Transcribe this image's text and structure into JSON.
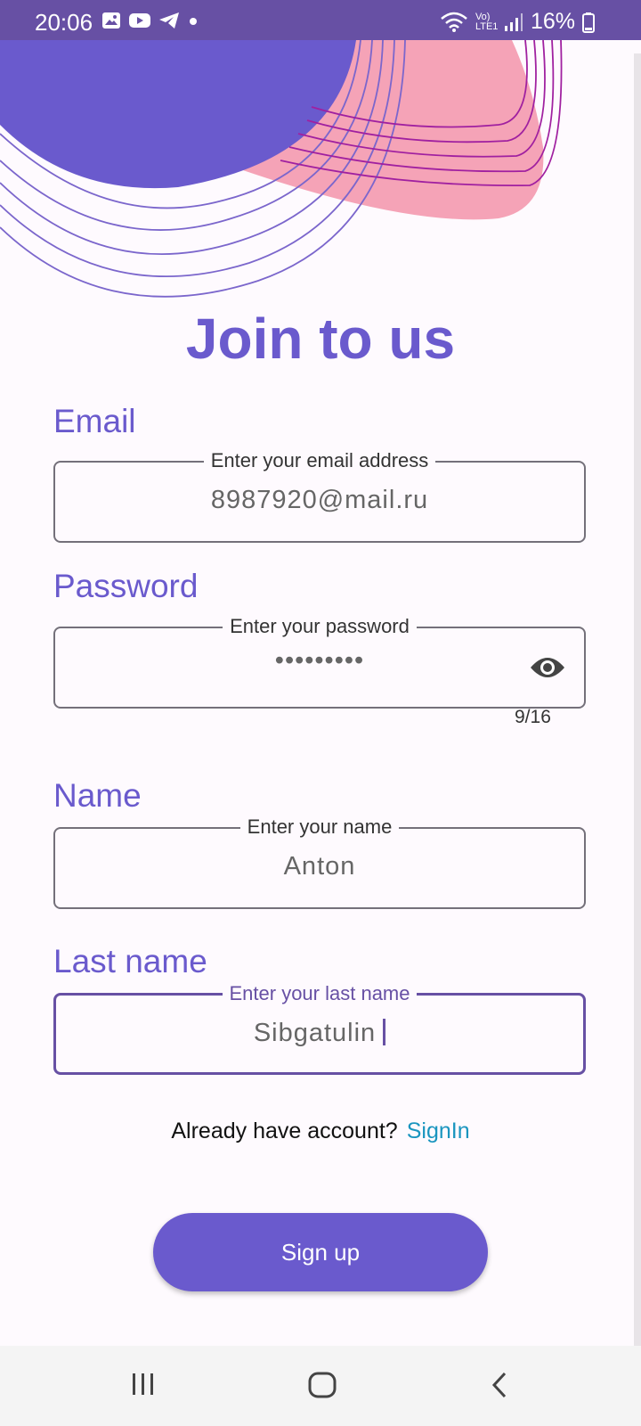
{
  "status": {
    "time": "20:06",
    "battery": "16%",
    "network": "Vo) LTE1"
  },
  "page": {
    "title": "Join to us"
  },
  "form": {
    "email": {
      "label": "Email",
      "hint": "Enter your email address",
      "value": "8987920@mail.ru"
    },
    "password": {
      "label": "Password",
      "hint": "Enter your password",
      "value": "•••••••••",
      "counter": "9/16"
    },
    "name": {
      "label": "Name",
      "hint": "Enter your name",
      "value": "Anton"
    },
    "last_name": {
      "label": "Last name",
      "hint": "Enter your last name",
      "value": "Sibgatulin"
    }
  },
  "signin": {
    "prompt": "Already have account?",
    "link": "SignIn"
  },
  "signup_button": "Sign up",
  "colors": {
    "accent": "#6a5acd",
    "status_bar": "#6750a4",
    "pink": "#f5a3b7",
    "link": "#1a95bf"
  }
}
